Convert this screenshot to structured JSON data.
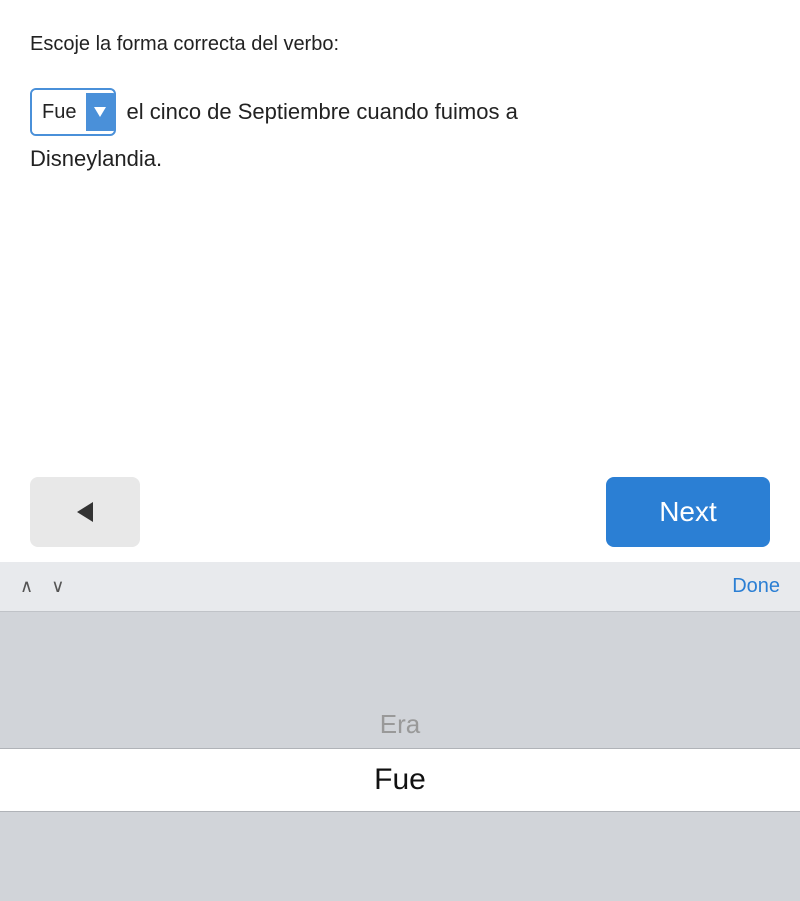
{
  "question": {
    "instruction": "Escoje la forma correcta del verbo:",
    "sentence_part1": "el cinco de Septiembre cuando fuimos a",
    "sentence_part2": "Disneylandia.",
    "selected_option": "Fue"
  },
  "navigation": {
    "back_label": "◄",
    "next_label": "Next"
  },
  "picker": {
    "done_label": "Done",
    "up_label": "∧",
    "down_label": "∨",
    "options": [
      {
        "value": "Era",
        "selected": false
      },
      {
        "value": "Fue",
        "selected": true
      }
    ]
  },
  "colors": {
    "blue": "#2b7fd4",
    "dropdown_border": "#4a90d9",
    "picker_bg": "#d1d4d9",
    "toolbar_bg": "#e8eaed",
    "back_btn_bg": "#e8e8e8"
  }
}
